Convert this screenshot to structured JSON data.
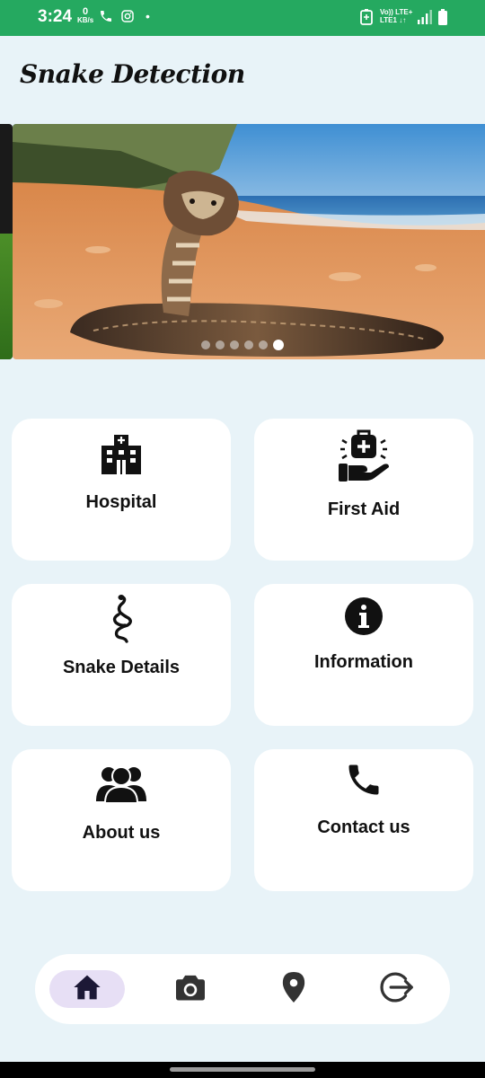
{
  "status_bar": {
    "time": "3:24",
    "speed_value": "0",
    "speed_unit": "KB/s",
    "network_top": "Vo)) LTE+",
    "network_bottom": "LTE1 ↓↑",
    "bg_color": "#25a960"
  },
  "header": {
    "title": "Snake Detection"
  },
  "carousel": {
    "image_subject": "cobra on sandy beach",
    "slide_count": 6,
    "active_index": 5
  },
  "cards": [
    {
      "label": "Hospital",
      "icon": "hospital-icon"
    },
    {
      "label": "First Aid",
      "icon": "first-aid-icon"
    },
    {
      "label": "Snake Details",
      "icon": "snake-icon"
    },
    {
      "label": "Information",
      "icon": "info-icon"
    },
    {
      "label": "About us",
      "icon": "people-icon"
    },
    {
      "label": "Contact us",
      "icon": "phone-icon"
    }
  ],
  "bottom_nav": {
    "items": [
      {
        "icon": "home-icon",
        "active": true
      },
      {
        "icon": "camera-icon",
        "active": false
      },
      {
        "icon": "location-pin-icon",
        "active": false
      },
      {
        "icon": "logout-icon",
        "active": false
      }
    ],
    "active_color": "#e7dff5"
  },
  "colors": {
    "background": "#e8f3f8",
    "card": "#ffffff",
    "icon": "#111111"
  }
}
